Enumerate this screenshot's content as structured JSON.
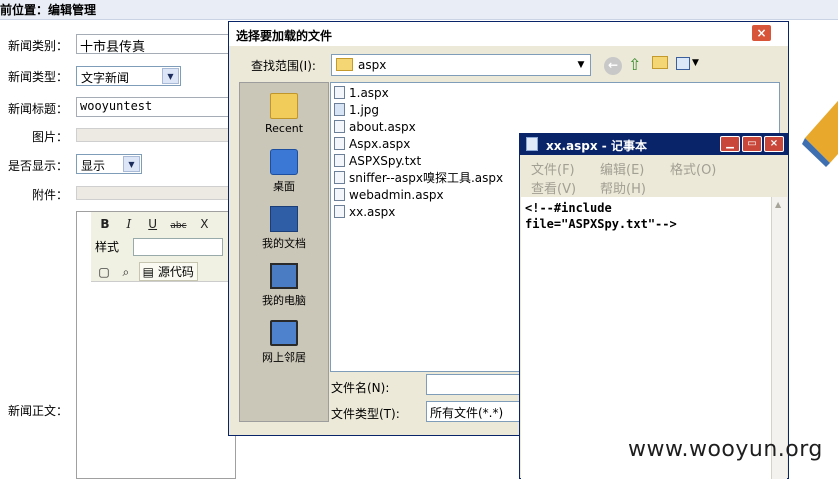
{
  "breadcrumb": {
    "prefix": "前位置：",
    "current": "编辑管理"
  },
  "form": {
    "category_label": "新闻类别：",
    "category_value": "十市县传真",
    "type_label": "新闻类型：",
    "type_value": "文字新闻",
    "title_label": "新闻标题：",
    "title_value": "wooyuntest",
    "image_label": "图片：",
    "display_label": "是否显示：",
    "display_value": "显示",
    "attachment_label": "附件：",
    "body_label": "新闻正文："
  },
  "editor": {
    "bold": "B",
    "italic": "I",
    "underline": "U",
    "strike": "abc",
    "subscript": "X",
    "style_label": "样式",
    "source_label": "源代码"
  },
  "dialog": {
    "title": "选择要加载的文件",
    "close": "×",
    "lookin_label": "查找范围(I):",
    "lookin_value": "aspx",
    "places": [
      {
        "label": "Recent"
      },
      {
        "label": "桌面"
      },
      {
        "label": "我的文档"
      },
      {
        "label": "我的电脑"
      },
      {
        "label": "网上邻居"
      }
    ],
    "files": [
      "1.aspx",
      "1.jpg",
      "about.aspx",
      "Aspx.aspx",
      "ASPXSpy.txt",
      "sniffer--aspx嗅探工具.aspx",
      "webadmin.aspx",
      "xx.aspx"
    ],
    "filename_label": "文件名(N):",
    "filetype_label": "文件类型(T):",
    "filetype_value": "所有文件(*.*)"
  },
  "notepad": {
    "title": "xx.aspx - 记事本",
    "menu": [
      "文件(F)",
      "编辑(E)",
      "格式(O)",
      "查看(V)",
      "帮助(H)"
    ],
    "content": "<!--#include\nfile=\"ASPXSpy.txt\"-->"
  },
  "watermark": "www.wooyun.org",
  "colors": {
    "dialog_title_bg": "#ffffff",
    "notepad_title_bg": "#0a246a",
    "xp_face": "#ece9d8"
  }
}
